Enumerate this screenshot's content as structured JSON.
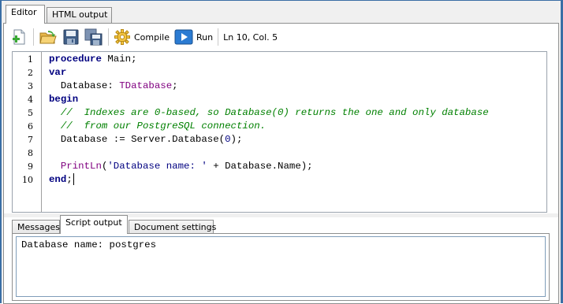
{
  "top_tabs": {
    "editor": "Editor",
    "html_output": "HTML output"
  },
  "toolbar": {
    "new_icon": "new-script-icon",
    "open_icon": "open-folder-icon",
    "save_icon": "save-icon",
    "save_all_icon": "save-all-icon",
    "compile_label": "Compile",
    "run_label": "Run",
    "cursor_position": "Ln 10, Col. 5"
  },
  "editor": {
    "line_numbers": [
      "1",
      "2",
      "3",
      "4",
      "5",
      "6",
      "7",
      "8",
      "9",
      "10"
    ],
    "code_lines": [
      "procedure Main;",
      "var",
      "  Database: TDatabase;",
      "begin",
      "  //  Indexes are 0-based, so Database(0) returns the one and only database",
      "  //  from our PostgreSQL connection.",
      "  Database := Server.Database(0);",
      "",
      "  PrintLn('Database name: ' + Database.Name);",
      "end;"
    ]
  },
  "bottom_tabs": {
    "messages": "Messages",
    "script_output": "Script output",
    "document_settings": "Document settings"
  },
  "output": {
    "text": "Database name: postgres"
  },
  "colors": {
    "keyword": "#000080",
    "type": "#800080",
    "comment": "#008000",
    "window_border": "#3a6ea5"
  }
}
